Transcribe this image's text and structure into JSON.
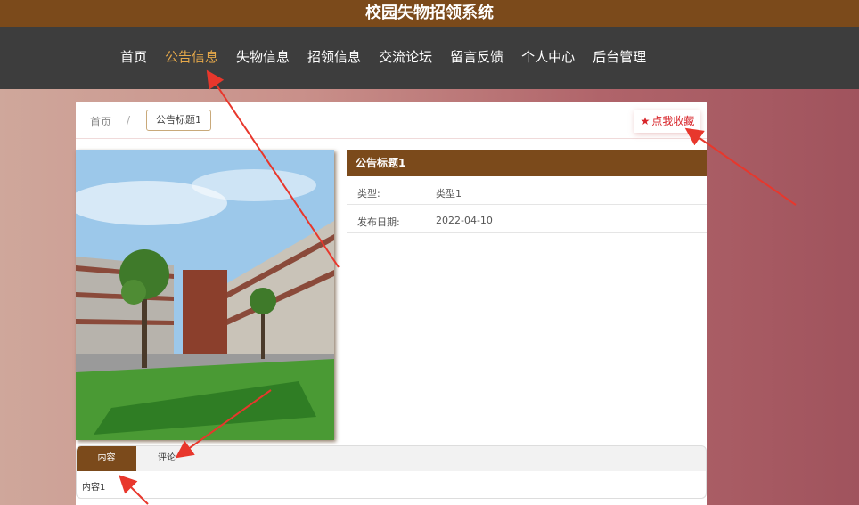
{
  "header": {
    "title": "校园失物招领系统"
  },
  "nav": {
    "items": [
      {
        "label": "首页",
        "active": false
      },
      {
        "label": "公告信息",
        "active": true
      },
      {
        "label": "失物信息",
        "active": false
      },
      {
        "label": "招领信息",
        "active": false
      },
      {
        "label": "交流论坛",
        "active": false
      },
      {
        "label": "留言反馈",
        "active": false
      },
      {
        "label": "个人中心",
        "active": false
      },
      {
        "label": "后台管理",
        "active": false
      }
    ]
  },
  "breadcrumb": {
    "home": "首页",
    "separator": "/",
    "current": "公告标题1"
  },
  "favorite": {
    "label": "点我收藏",
    "icon": "star-icon"
  },
  "detail": {
    "title": "公告标题1",
    "rows": [
      {
        "label": "类型:",
        "value": "类型1"
      },
      {
        "label": "发布日期:",
        "value": "2022-04-10"
      }
    ]
  },
  "tabs": {
    "items": [
      {
        "label": "内容",
        "active": true
      },
      {
        "label": "评论",
        "active": false
      }
    ],
    "content": "内容1"
  },
  "colors": {
    "brand": "#7b4a1b",
    "nav_bg": "#3d3d3d",
    "active_nav": "#e6a94a",
    "favorite": "#d8262b"
  }
}
